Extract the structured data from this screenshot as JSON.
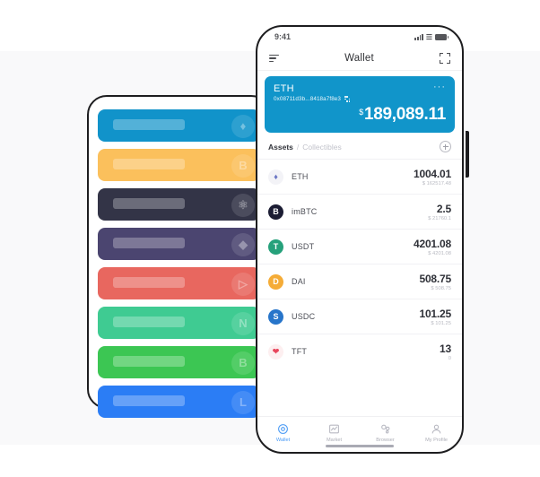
{
  "background": {
    "band_color": "#f9f9fa",
    "page_color": "#ffffff"
  },
  "left_panel": {
    "name": "placeholder-card-stack",
    "cards": [
      {
        "color": "#1193ca",
        "icon": "ethereum-icon",
        "glyph": "♦"
      },
      {
        "color": "#fbc05c",
        "icon": "bitcoin-icon",
        "glyph": "B"
      },
      {
        "color": "#333447",
        "icon": "atom-icon",
        "glyph": "⚛"
      },
      {
        "color": "#4b4570",
        "icon": "droplet-icon",
        "glyph": "◆"
      },
      {
        "color": "#e8675f",
        "icon": "tron-icon",
        "glyph": "▷"
      },
      {
        "color": "#3fcb92",
        "icon": "nano-icon",
        "glyph": "N"
      },
      {
        "color": "#3cc653",
        "icon": "bch-icon",
        "glyph": "B"
      },
      {
        "color": "#2b7df5",
        "icon": "litecoin-icon",
        "glyph": "L"
      }
    ]
  },
  "phone": {
    "status_bar": {
      "time": "9:41",
      "signal_icon": "cellular-signal-icon",
      "wifi_icon": "wifi-icon",
      "battery_icon": "battery-icon"
    },
    "nav_bar": {
      "menu_icon": "hamburger-menu-icon",
      "title": "Wallet",
      "scan_icon": "scan-qr-icon"
    },
    "wallet_card": {
      "color": "#1195ca",
      "name": "ETH",
      "address": "0x08711d3b...8418a7f8e3",
      "copy_icon": "qr-code-icon",
      "more_icon": "···",
      "currency_symbol": "$",
      "balance": "189,089.11"
    },
    "asset_tabs": {
      "assets_label": "Assets",
      "separator": "/",
      "collectibles_label": "Collectibles",
      "add_icon": "plus-circle-icon"
    },
    "assets": [
      {
        "symbol": "ETH",
        "amount": "1004.01",
        "fiat": "$ 162517.48",
        "color": "#f3f3f7",
        "text_color": "#6b76c4",
        "glyph": "♦",
        "icon": "eth-coin-icon"
      },
      {
        "symbol": "imBTC",
        "amount": "2.5",
        "fiat": "$ 21760.1",
        "color": "#1b1c33",
        "text_color": "#ffffff",
        "glyph": "B",
        "icon": "imbtc-coin-icon"
      },
      {
        "symbol": "USDT",
        "amount": "4201.08",
        "fiat": "$ 4201.08",
        "color": "#26a17b",
        "text_color": "#ffffff",
        "glyph": "T",
        "icon": "usdt-coin-icon"
      },
      {
        "symbol": "DAI",
        "amount": "508.75",
        "fiat": "$ 508.75",
        "color": "#f5ac37",
        "text_color": "#ffffff",
        "glyph": "D",
        "icon": "dai-coin-icon"
      },
      {
        "symbol": "USDC",
        "amount": "101.25",
        "fiat": "$ 101.25",
        "color": "#2775ca",
        "text_color": "#ffffff",
        "glyph": "S",
        "icon": "usdc-coin-icon"
      },
      {
        "symbol": "TFT",
        "amount": "13",
        "fiat": "0",
        "color": "#fdeff0",
        "text_color": "#e8455c",
        "glyph": "❤",
        "icon": "tft-coin-icon"
      }
    ],
    "tab_bar": [
      {
        "label": "Wallet",
        "icon": "wallet-tab-icon",
        "active": true
      },
      {
        "label": "Market",
        "icon": "market-tab-icon",
        "active": false
      },
      {
        "label": "Browser",
        "icon": "browser-tab-icon",
        "active": false
      },
      {
        "label": "My Profile",
        "icon": "profile-tab-icon",
        "active": false
      }
    ],
    "active_color": "#4b9bf5"
  }
}
